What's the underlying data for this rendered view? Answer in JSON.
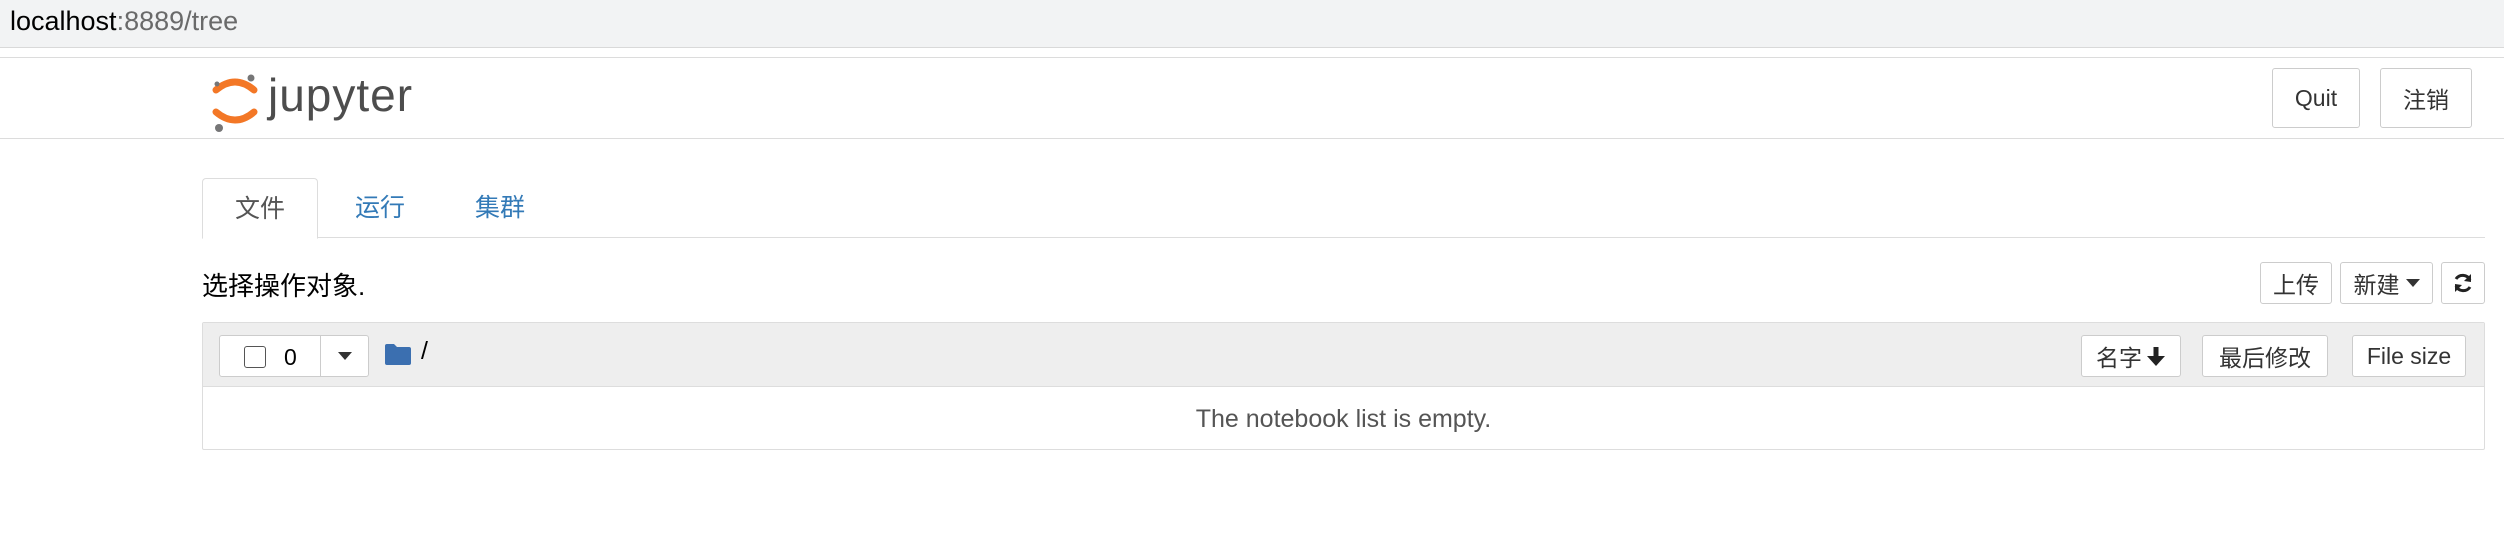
{
  "url": {
    "host": "localhost",
    "rest": ":8889/tree"
  },
  "header": {
    "logo_text": "jupyter",
    "quit_label": "Quit",
    "logout_label": "注销"
  },
  "tabs": [
    {
      "label": "文件",
      "active": true
    },
    {
      "label": "运行",
      "active": false
    },
    {
      "label": "集群",
      "active": false
    }
  ],
  "toolbar": {
    "select_label": "选择操作对象.",
    "upload_label": "上传",
    "new_label": "新建",
    "refresh_icon": "refresh-icon"
  },
  "list": {
    "selected_count": "0",
    "path": "/",
    "sort_name_label": "名字",
    "last_modified_label": "最后修改",
    "file_size_label": "File size",
    "empty_message": "The notebook list is empty."
  },
  "colors": {
    "link": "#337ab7",
    "folder": "#3b6fb0",
    "logo_orange": "#f37726",
    "logo_gray": "#767677"
  }
}
